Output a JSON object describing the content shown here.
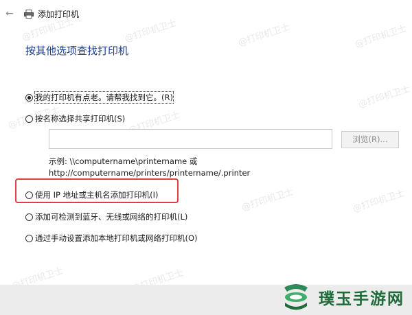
{
  "window": {
    "title": "添加打印机"
  },
  "heading": "按其他选项查找打印机",
  "options": [
    {
      "label": "我的打印机有点老。请帮我找到它。(R)",
      "checked": true,
      "focused": true
    },
    {
      "label": "按名称选择共享打印机(S)",
      "checked": false,
      "focused": false
    },
    {
      "label": "使用 IP 地址或主机名添加打印机(I)",
      "checked": false,
      "focused": false
    },
    {
      "label": "添加可检测到蓝牙、无线或网络的打印机(L)",
      "checked": false,
      "focused": false
    },
    {
      "label": "通过手动设置添加本地打印机或网络打印机(O)",
      "checked": false,
      "focused": false
    }
  ],
  "shared_printer": {
    "input_value": "",
    "browse_label": "浏览(R)...",
    "example_line1": "示例: \\\\computername\\printername 或",
    "example_line2": "http://computername/printers/printername/.printer"
  },
  "watermark": "@打印机卫士",
  "brand": {
    "name": "璞玉手游网",
    "color": "#1f6b3a"
  },
  "highlight_color": "#e0403c"
}
